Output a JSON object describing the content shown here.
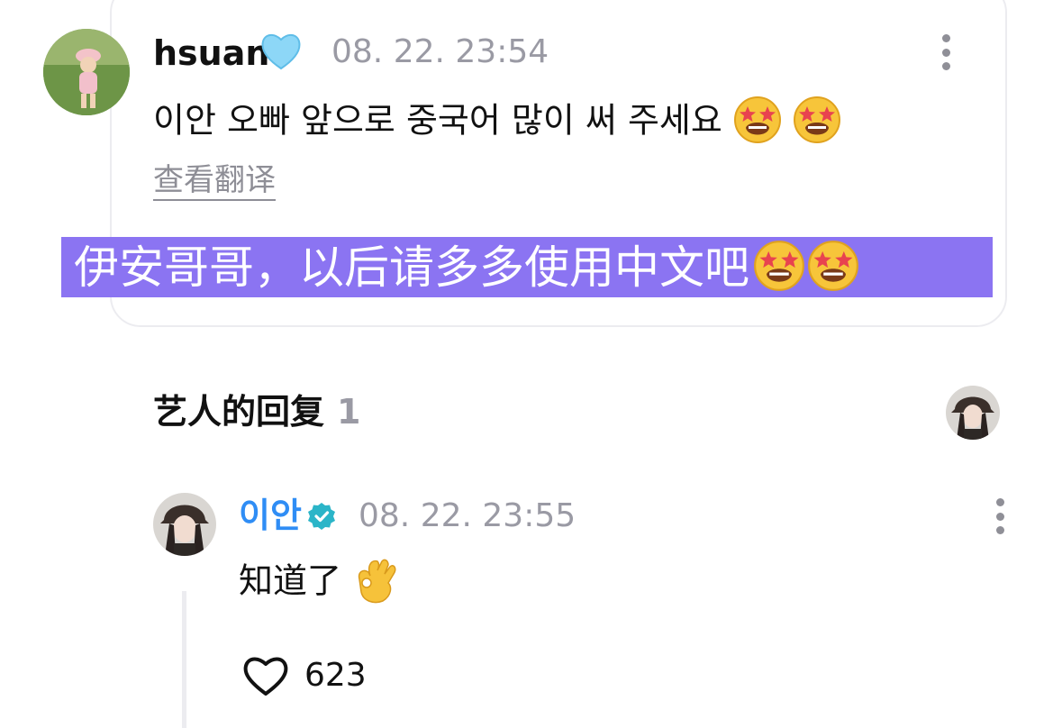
{
  "comment": {
    "username": "hsuan",
    "username_emoji": "light-blue-heart",
    "timestamp": "08. 22. 23:54",
    "text": "이안 오빠 앞으로 중국어 많이 써 주세요",
    "text_emojis": [
      "star-struck",
      "star-struck"
    ],
    "translate_link": "查看翻译",
    "translation": "伊安哥哥，以后请多多使用中文吧",
    "translation_emojis": [
      "star-struck",
      "star-struck"
    ]
  },
  "artist_replies": {
    "title": "艺人的回复",
    "count": "1"
  },
  "reply": {
    "username": "이안",
    "verified": true,
    "timestamp": "08. 22. 23:55",
    "text": "知道了",
    "text_emoji": "ok-hand",
    "like_count": "623"
  },
  "colors": {
    "translation_highlight": "#8b74f2",
    "reply_username": "#2f8df5",
    "verified_badge": "#2bb5c8",
    "muted_text": "#9a9aa4",
    "card_border": "#ececf0"
  },
  "icons": [
    "more-options-icon",
    "heart-icon",
    "verified-badge-icon",
    "light-blue-heart-icon",
    "star-struck-emoji",
    "ok-hand-emoji"
  ]
}
